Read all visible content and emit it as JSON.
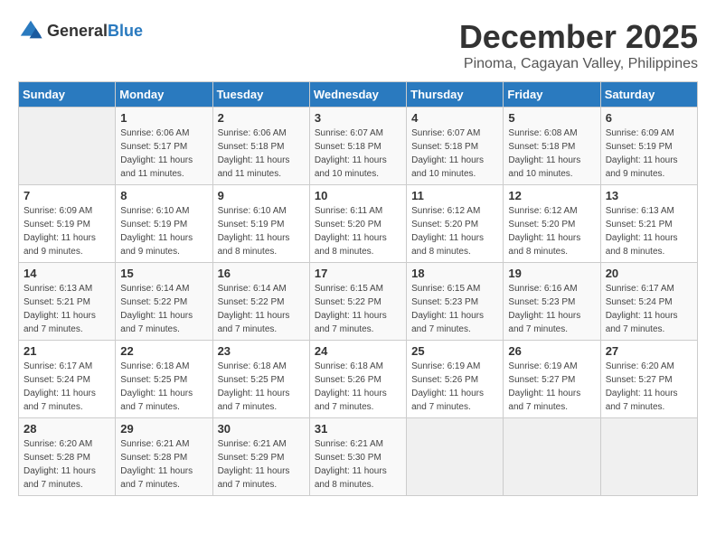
{
  "logo": {
    "text_general": "General",
    "text_blue": "Blue"
  },
  "title": {
    "month": "December 2025",
    "location": "Pinoma, Cagayan Valley, Philippines"
  },
  "weekdays": [
    "Sunday",
    "Monday",
    "Tuesday",
    "Wednesday",
    "Thursday",
    "Friday",
    "Saturday"
  ],
  "weeks": [
    [
      {
        "day": "",
        "sunrise": "",
        "sunset": "",
        "daylight": "",
        "empty": true
      },
      {
        "day": "1",
        "sunrise": "Sunrise: 6:06 AM",
        "sunset": "Sunset: 5:17 PM",
        "daylight": "Daylight: 11 hours and 11 minutes."
      },
      {
        "day": "2",
        "sunrise": "Sunrise: 6:06 AM",
        "sunset": "Sunset: 5:18 PM",
        "daylight": "Daylight: 11 hours and 11 minutes."
      },
      {
        "day": "3",
        "sunrise": "Sunrise: 6:07 AM",
        "sunset": "Sunset: 5:18 PM",
        "daylight": "Daylight: 11 hours and 10 minutes."
      },
      {
        "day": "4",
        "sunrise": "Sunrise: 6:07 AM",
        "sunset": "Sunset: 5:18 PM",
        "daylight": "Daylight: 11 hours and 10 minutes."
      },
      {
        "day": "5",
        "sunrise": "Sunrise: 6:08 AM",
        "sunset": "Sunset: 5:18 PM",
        "daylight": "Daylight: 11 hours and 10 minutes."
      },
      {
        "day": "6",
        "sunrise": "Sunrise: 6:09 AM",
        "sunset": "Sunset: 5:19 PM",
        "daylight": "Daylight: 11 hours and 9 minutes."
      }
    ],
    [
      {
        "day": "7",
        "sunrise": "Sunrise: 6:09 AM",
        "sunset": "Sunset: 5:19 PM",
        "daylight": "Daylight: 11 hours and 9 minutes."
      },
      {
        "day": "8",
        "sunrise": "Sunrise: 6:10 AM",
        "sunset": "Sunset: 5:19 PM",
        "daylight": "Daylight: 11 hours and 9 minutes."
      },
      {
        "day": "9",
        "sunrise": "Sunrise: 6:10 AM",
        "sunset": "Sunset: 5:19 PM",
        "daylight": "Daylight: 11 hours and 8 minutes."
      },
      {
        "day": "10",
        "sunrise": "Sunrise: 6:11 AM",
        "sunset": "Sunset: 5:20 PM",
        "daylight": "Daylight: 11 hours and 8 minutes."
      },
      {
        "day": "11",
        "sunrise": "Sunrise: 6:12 AM",
        "sunset": "Sunset: 5:20 PM",
        "daylight": "Daylight: 11 hours and 8 minutes."
      },
      {
        "day": "12",
        "sunrise": "Sunrise: 6:12 AM",
        "sunset": "Sunset: 5:20 PM",
        "daylight": "Daylight: 11 hours and 8 minutes."
      },
      {
        "day": "13",
        "sunrise": "Sunrise: 6:13 AM",
        "sunset": "Sunset: 5:21 PM",
        "daylight": "Daylight: 11 hours and 8 minutes."
      }
    ],
    [
      {
        "day": "14",
        "sunrise": "Sunrise: 6:13 AM",
        "sunset": "Sunset: 5:21 PM",
        "daylight": "Daylight: 11 hours and 7 minutes."
      },
      {
        "day": "15",
        "sunrise": "Sunrise: 6:14 AM",
        "sunset": "Sunset: 5:22 PM",
        "daylight": "Daylight: 11 hours and 7 minutes."
      },
      {
        "day": "16",
        "sunrise": "Sunrise: 6:14 AM",
        "sunset": "Sunset: 5:22 PM",
        "daylight": "Daylight: 11 hours and 7 minutes."
      },
      {
        "day": "17",
        "sunrise": "Sunrise: 6:15 AM",
        "sunset": "Sunset: 5:22 PM",
        "daylight": "Daylight: 11 hours and 7 minutes."
      },
      {
        "day": "18",
        "sunrise": "Sunrise: 6:15 AM",
        "sunset": "Sunset: 5:23 PM",
        "daylight": "Daylight: 11 hours and 7 minutes."
      },
      {
        "day": "19",
        "sunrise": "Sunrise: 6:16 AM",
        "sunset": "Sunset: 5:23 PM",
        "daylight": "Daylight: 11 hours and 7 minutes."
      },
      {
        "day": "20",
        "sunrise": "Sunrise: 6:17 AM",
        "sunset": "Sunset: 5:24 PM",
        "daylight": "Daylight: 11 hours and 7 minutes."
      }
    ],
    [
      {
        "day": "21",
        "sunrise": "Sunrise: 6:17 AM",
        "sunset": "Sunset: 5:24 PM",
        "daylight": "Daylight: 11 hours and 7 minutes."
      },
      {
        "day": "22",
        "sunrise": "Sunrise: 6:18 AM",
        "sunset": "Sunset: 5:25 PM",
        "daylight": "Daylight: 11 hours and 7 minutes."
      },
      {
        "day": "23",
        "sunrise": "Sunrise: 6:18 AM",
        "sunset": "Sunset: 5:25 PM",
        "daylight": "Daylight: 11 hours and 7 minutes."
      },
      {
        "day": "24",
        "sunrise": "Sunrise: 6:18 AM",
        "sunset": "Sunset: 5:26 PM",
        "daylight": "Daylight: 11 hours and 7 minutes."
      },
      {
        "day": "25",
        "sunrise": "Sunrise: 6:19 AM",
        "sunset": "Sunset: 5:26 PM",
        "daylight": "Daylight: 11 hours and 7 minutes."
      },
      {
        "day": "26",
        "sunrise": "Sunrise: 6:19 AM",
        "sunset": "Sunset: 5:27 PM",
        "daylight": "Daylight: 11 hours and 7 minutes."
      },
      {
        "day": "27",
        "sunrise": "Sunrise: 6:20 AM",
        "sunset": "Sunset: 5:27 PM",
        "daylight": "Daylight: 11 hours and 7 minutes."
      }
    ],
    [
      {
        "day": "28",
        "sunrise": "Sunrise: 6:20 AM",
        "sunset": "Sunset: 5:28 PM",
        "daylight": "Daylight: 11 hours and 7 minutes."
      },
      {
        "day": "29",
        "sunrise": "Sunrise: 6:21 AM",
        "sunset": "Sunset: 5:28 PM",
        "daylight": "Daylight: 11 hours and 7 minutes."
      },
      {
        "day": "30",
        "sunrise": "Sunrise: 6:21 AM",
        "sunset": "Sunset: 5:29 PM",
        "daylight": "Daylight: 11 hours and 7 minutes."
      },
      {
        "day": "31",
        "sunrise": "Sunrise: 6:21 AM",
        "sunset": "Sunset: 5:30 PM",
        "daylight": "Daylight: 11 hours and 8 minutes."
      },
      {
        "day": "",
        "sunrise": "",
        "sunset": "",
        "daylight": "",
        "empty": true
      },
      {
        "day": "",
        "sunrise": "",
        "sunset": "",
        "daylight": "",
        "empty": true
      },
      {
        "day": "",
        "sunrise": "",
        "sunset": "",
        "daylight": "",
        "empty": true
      }
    ]
  ]
}
